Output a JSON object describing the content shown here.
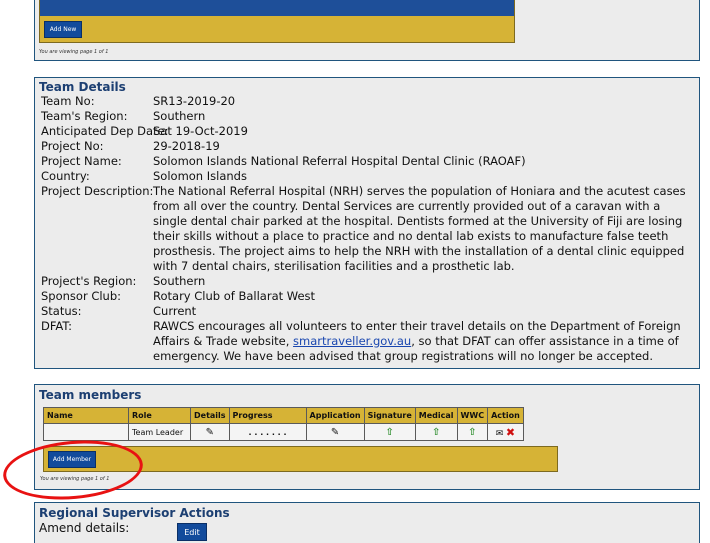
{
  "top_section": {
    "add_new_label": "Add New",
    "viewing_note": "You are viewing page 1 of 1"
  },
  "team_details": {
    "title": "Team Details",
    "rows": [
      {
        "label": "Team No:",
        "value": "SR13-2019-20"
      },
      {
        "label": "Team's Region:",
        "value": "Southern"
      },
      {
        "label": "Anticipated Dep Date:",
        "value": "Sat 19-Oct-2019"
      },
      {
        "label": "Project No:",
        "value": "29-2018-19"
      },
      {
        "label": "Project Name:",
        "value": "Solomon Islands National Referral Hospital Dental Clinic (RAOAF)"
      },
      {
        "label": "Country:",
        "value": "Solomon Islands"
      },
      {
        "label": "Project Description:",
        "value": "The National Referral Hospital (NRH) serves the population of Honiara and the acutest cases from all over the country. Dental Services are currently provided out of a caravan with a single dental chair parked at the hospital. Dentists formed at the University of Fiji are losing their skills without a place to practice and no dental lab exists to manufacture false teeth prosthesis. The project aims to help the NRH with the installation of a dental clinic equipped with 7 dental chairs, sterilisation facilities and a prosthetic lab."
      },
      {
        "label": "Project's Region:",
        "value": "Southern"
      },
      {
        "label": "Sponsor Club:",
        "value": "Rotary Club of Ballarat West"
      },
      {
        "label": "Status:",
        "value": "Current"
      },
      {
        "label": "DFAT:",
        "value_before_link": "RAWCS encourages all volunteers to enter their travel details on the Department of Foreign Affairs & Trade website, ",
        "link_text": "smartraveller.gov.au",
        "value_after_link": ", so that DFAT can offer assistance in a time of emergency. We have been advised that group registrations will no longer be accepted."
      }
    ]
  },
  "team_members": {
    "title": "Team members",
    "columns": [
      "Name",
      "Role",
      "Details",
      "Progress",
      "Application",
      "Signature",
      "Medical",
      "WWC",
      "Action"
    ],
    "rows": [
      {
        "name": "",
        "role": "Team Leader",
        "progress": ". . . . . . ."
      }
    ],
    "add_member_label": "Add Member",
    "viewing_note": "You are viewing page 1 of 1"
  },
  "supervisor": {
    "title": "Regional Supervisor Actions",
    "amend_label": "Amend details:",
    "edit_label": "Edit"
  },
  "colors": {
    "accent_gold": "#d6b336",
    "button_blue": "#124b9c",
    "title_blue": "#1c3f72",
    "annotation_red": "#e81212"
  },
  "icons": [
    "pencil-icon",
    "upload-icon",
    "envelope-icon",
    "delete-icon"
  ]
}
